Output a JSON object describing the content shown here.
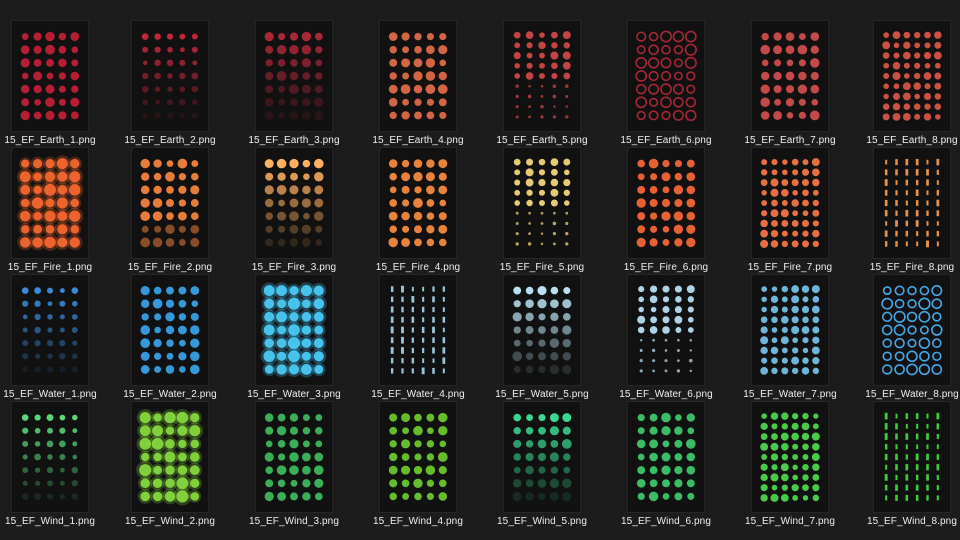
{
  "explorer": {
    "view": "large-icons",
    "files": [
      {
        "name": "15_EF_Earth_1.png",
        "color": "#c8203a",
        "style": "blob"
      },
      {
        "name": "15_EF_Earth_2.png",
        "color": "#c0283a",
        "style": "sparse"
      },
      {
        "name": "15_EF_Earth_3.png",
        "color": "#a82838",
        "style": "fade"
      },
      {
        "name": "15_EF_Earth_4.png",
        "color": "#e8704a",
        "style": "blob"
      },
      {
        "name": "15_EF_Earth_5.png",
        "color": "#d84a4a",
        "style": "column"
      },
      {
        "name": "15_EF_Earth_6.png",
        "color": "#b82a3a",
        "style": "ring"
      },
      {
        "name": "15_EF_Earth_7.png",
        "color": "#d85050",
        "style": "wide"
      },
      {
        "name": "15_EF_Earth_8.png",
        "color": "#e05a48",
        "style": "dense"
      },
      {
        "name": "15_EF_Fire_1.png",
        "color": "#ff6a30",
        "style": "glow"
      },
      {
        "name": "15_EF_Fire_2.png",
        "color": "#ff8a40",
        "style": "mixed"
      },
      {
        "name": "15_EF_Fire_3.png",
        "color": "#ffb060",
        "style": "fade"
      },
      {
        "name": "15_EF_Fire_4.png",
        "color": "#ff9040",
        "style": "blob"
      },
      {
        "name": "15_EF_Fire_5.png",
        "color": "#ffe080",
        "style": "column"
      },
      {
        "name": "15_EF_Fire_6.png",
        "color": "#ff6a38",
        "style": "blob"
      },
      {
        "name": "15_EF_Fire_7.png",
        "color": "#ff7a48",
        "style": "dense"
      },
      {
        "name": "15_EF_Fire_8.png",
        "color": "#ffa050",
        "style": "tall"
      },
      {
        "name": "15_EF_Water_1.png",
        "color": "#3a8ad8",
        "style": "sparse"
      },
      {
        "name": "15_EF_Water_2.png",
        "color": "#3aa8f0",
        "style": "blob"
      },
      {
        "name": "15_EF_Water_3.png",
        "color": "#4ad0ff",
        "style": "glow"
      },
      {
        "name": "15_EF_Water_4.png",
        "color": "#a8d8f0",
        "style": "tall"
      },
      {
        "name": "15_EF_Water_5.png",
        "color": "#b8e0f0",
        "style": "fade"
      },
      {
        "name": "15_EF_Water_6.png",
        "color": "#c0e8ff",
        "style": "column"
      },
      {
        "name": "15_EF_Water_7.png",
        "color": "#7ac8f0",
        "style": "dense"
      },
      {
        "name": "15_EF_Water_8.png",
        "color": "#4ab8ff",
        "style": "ring"
      },
      {
        "name": "15_EF_Wind_1.png",
        "color": "#5ad87a",
        "style": "sparse"
      },
      {
        "name": "15_EF_Wind_2.png",
        "color": "#8ae040",
        "style": "glow"
      },
      {
        "name": "15_EF_Wind_3.png",
        "color": "#40c060",
        "style": "blob"
      },
      {
        "name": "15_EF_Wind_4.png",
        "color": "#70d030",
        "style": "blob"
      },
      {
        "name": "15_EF_Wind_5.png",
        "color": "#3ad890",
        "style": "fade"
      },
      {
        "name": "15_EF_Wind_6.png",
        "color": "#40d070",
        "style": "blob"
      },
      {
        "name": "15_EF_Wind_7.png",
        "color": "#50e050",
        "style": "dense"
      },
      {
        "name": "15_EF_Wind_8.png",
        "color": "#40e040",
        "style": "tall"
      }
    ]
  }
}
